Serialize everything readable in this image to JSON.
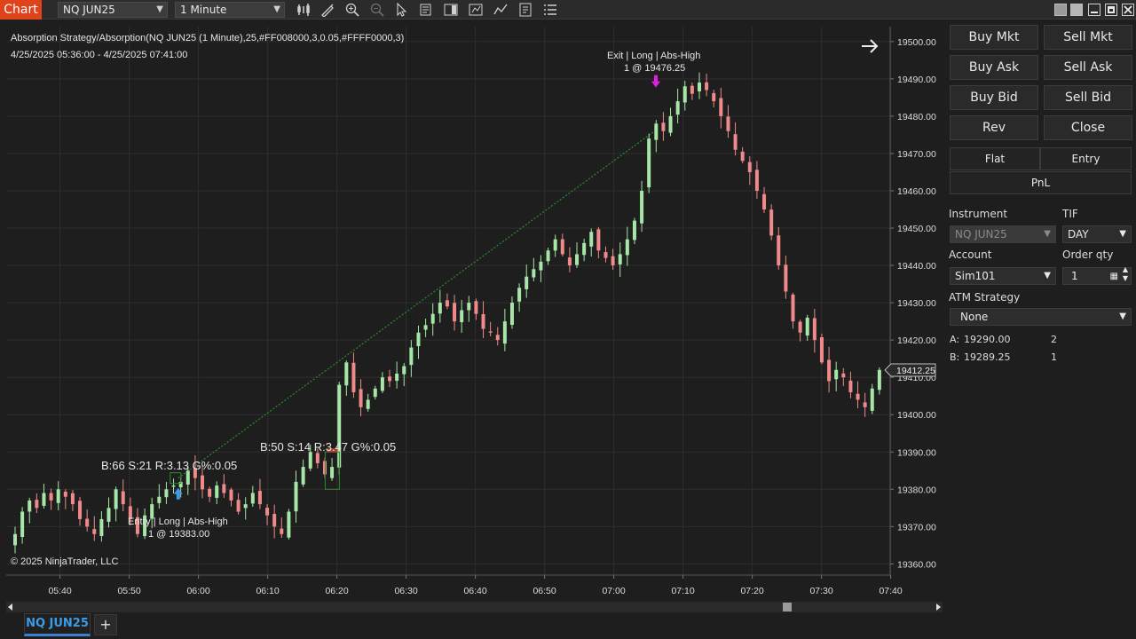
{
  "toolbar": {
    "app_label": "Chart",
    "instrument_select": "NQ JUN25",
    "interval_select": "1 Minute",
    "icons": [
      "bar-type-icon",
      "draw-tool-icon",
      "zoom-in-icon",
      "zoom-out-icon",
      "pointer-icon",
      "data-box-icon",
      "chart-trader-icon",
      "strategies-icon",
      "indicators-icon",
      "properties-icon",
      "list-icon"
    ]
  },
  "chart": {
    "title_line": "Absorption Strategy/Absorption(NQ JUN25 (1 Minute),25,#FF008000,3,0.05,#FFFF0000,3)",
    "date_range": "4/25/2025 05:36:00 - 4/25/2025 07:41:00",
    "copyright": "© 2025 NinjaTrader, LLC",
    "current_price": "19412.25",
    "annotation_1": "B:66 S:21 R:3.13 G%:0.05",
    "annotation_2": "B:50 S:14 R:3.47 G%:0.05",
    "entry_label_1": "Entry | Long | Abs-High",
    "entry_label_2": "1 @ 19383.00",
    "exit_label_1": "Exit | Long | Abs-High",
    "exit_label_2": "1 @ 19476.25",
    "colors": {
      "up": "#a6e6a6",
      "down": "#f08a8a",
      "entry_arrow": "#3a9be8",
      "exit_arrow": "#e020e0",
      "trade_line": "#2e8b2e"
    }
  },
  "chart_data": {
    "type": "candlestick",
    "y_ticks": [
      "19500.00",
      "19490.00",
      "19480.00",
      "19470.00",
      "19460.00",
      "19450.00",
      "19440.00",
      "19430.00",
      "19420.00",
      "19410.00",
      "19400.00",
      "19390.00",
      "19380.00",
      "19370.00",
      "19360.00"
    ],
    "x_ticks": [
      "05:40",
      "05:50",
      "06:00",
      "06:10",
      "06:20",
      "06:30",
      "06:40",
      "06:50",
      "07:00",
      "07:10",
      "07:20",
      "07:30",
      "07:40"
    ],
    "ylim": [
      19357,
      19504
    ],
    "time_range": [
      "05:38",
      "07:41"
    ],
    "closes": [
      19368,
      19374,
      19377,
      19375,
      19379,
      19377,
      19380,
      19378,
      19376,
      19372,
      19370,
      19368,
      19372,
      19375,
      19380,
      19376,
      19372,
      19368,
      19373,
      19376,
      19378,
      19380,
      19381,
      19382,
      19385,
      19383,
      19380,
      19378,
      19381,
      19379,
      19377,
      19374,
      19376,
      19379,
      19376,
      19373,
      19370,
      19368,
      19374,
      19382,
      19386,
      19390,
      19387,
      19384,
      19386,
      19408,
      19414,
      19406,
      19402,
      19404,
      19407,
      19410,
      19409,
      19411,
      19413,
      19418,
      19422,
      19424,
      19427,
      19430,
      19429,
      19425,
      19428,
      19430,
      19427,
      19423,
      19422,
      19420,
      19425,
      19430,
      19434,
      19437,
      19439,
      19441,
      19444,
      19447,
      19443,
      19440,
      19443,
      19446,
      19449,
      19444,
      19442,
      19440,
      19443,
      19447,
      19452,
      19460,
      19474,
      19478,
      19476,
      19480,
      19484,
      19488,
      19486,
      19489,
      19487,
      19484,
      19480,
      19476,
      19471,
      19468,
      19465,
      19460,
      19455,
      19448,
      19440,
      19433,
      19425,
      19422,
      19426,
      19420,
      19414,
      19409,
      19412,
      19410,
      19406,
      19404,
      19402,
      19407,
      19412
    ],
    "current_price": 19412.25,
    "entry": {
      "time": "05:59",
      "price": 19383.0
    },
    "exit": {
      "time": "07:08",
      "price": 19476.25
    }
  },
  "right_panel": {
    "buttons": {
      "buy_mkt": "Buy Mkt",
      "sell_mkt": "Sell Mkt",
      "buy_ask": "Buy Ask",
      "sell_ask": "Sell Ask",
      "buy_bid": "Buy Bid",
      "sell_bid": "Sell Bid",
      "rev": "Rev",
      "close": "Close"
    },
    "tabs": {
      "flat": "Flat",
      "entry": "Entry",
      "pnl": "PnL"
    },
    "instrument_label": "Instrument",
    "instrument_value": "NQ JUN25",
    "tif_label": "TIF",
    "tif_value": "DAY",
    "account_label": "Account",
    "account_value": "Sim101",
    "order_qty_label": "Order qty",
    "order_qty_value": "1",
    "atm_label": "ATM Strategy",
    "atm_value": "None",
    "ask_label": "A:",
    "ask_price": "19290.00",
    "ask_size": "2",
    "bid_label": "B:",
    "bid_price": "19289.25",
    "bid_size": "1"
  },
  "bottom": {
    "tab_label": "NQ JUN25",
    "add_tab": "+"
  }
}
